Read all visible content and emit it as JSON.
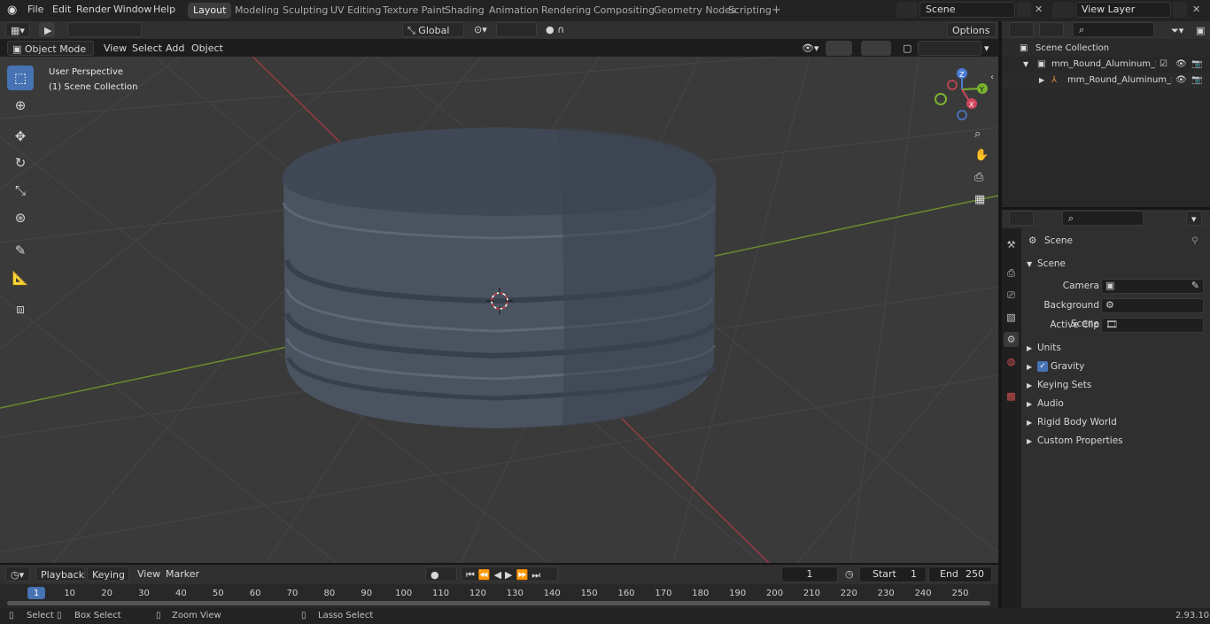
{
  "topbar": {
    "menus": [
      "File",
      "Edit",
      "Render",
      "Window",
      "Help"
    ],
    "workspaces": [
      "Layout",
      "Modeling",
      "Sculpting",
      "UV Editing",
      "Texture Paint",
      "Shading",
      "Animation",
      "Rendering",
      "Compositing",
      "Geometry Nodes",
      "Scripting"
    ],
    "active_workspace": "Layout",
    "add_workspace": "+",
    "scene_name": "Scene",
    "view_layer": "View Layer"
  },
  "viewport_header": {
    "mode": "Object Mode",
    "menus": [
      "View",
      "Select",
      "Add",
      "Object"
    ],
    "orientation": "Global",
    "options": "Options"
  },
  "viewport": {
    "perspective": "User Perspective",
    "collection": "(1) Scene Collection",
    "gizmo": {
      "z": "Z",
      "y": "Y",
      "x": "X"
    },
    "colors": {
      "background": "#3a3a3a",
      "grid": "#4a4a4a",
      "x_axis": "#9b3a44",
      "y_axis": "#6c8a2f",
      "object": "#4b5563"
    }
  },
  "toolbar": {
    "tools": [
      "select-box",
      "cursor",
      "move",
      "rotate",
      "scale",
      "transform",
      "annotate",
      "measure",
      "add-cube"
    ]
  },
  "outliner": {
    "root": "Scene Collection",
    "rows": [
      {
        "label": "mm_Round_Aluminum_Screw"
      },
      {
        "label": "mm_Round_Aluminum_S"
      }
    ]
  },
  "properties": {
    "context": "Scene",
    "panel": "Scene",
    "fields": [
      {
        "label": "Camera"
      },
      {
        "label": "Background Scene"
      },
      {
        "label": "Active Clip"
      }
    ],
    "subpanels": [
      "Units",
      "Gravity",
      "Keying Sets",
      "Audio",
      "Rigid Body World",
      "Custom Properties"
    ],
    "gravity_checked": true
  },
  "timeline": {
    "menus": [
      "Playback",
      "Keying",
      "View",
      "Marker"
    ],
    "current_frame": "1",
    "start_label": "Start",
    "start": "1",
    "end_label": "End",
    "end": "250",
    "ticks": [
      "1",
      "10",
      "20",
      "30",
      "40",
      "50",
      "60",
      "70",
      "80",
      "90",
      "100",
      "110",
      "120",
      "130",
      "140",
      "150",
      "160",
      "170",
      "180",
      "190",
      "200",
      "210",
      "220",
      "230",
      "240",
      "250"
    ]
  },
  "statusbar": {
    "select": "Select",
    "box_select": "Box Select",
    "zoom": "Zoom View",
    "lasso": "Lasso Select",
    "version": "2.93.10"
  },
  "accent": "#4772b3"
}
